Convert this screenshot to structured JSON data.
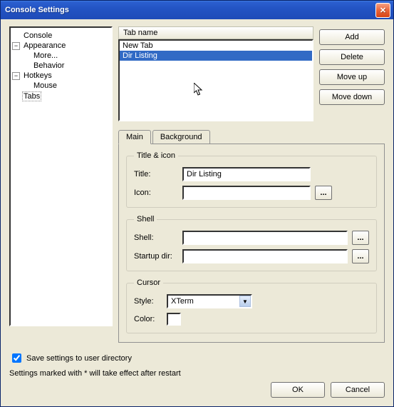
{
  "window": {
    "title": "Console Settings"
  },
  "tree": {
    "items": [
      {
        "label": "Console",
        "level": 0,
        "expand": "leaf"
      },
      {
        "label": "Appearance",
        "level": 0,
        "expand": "minus"
      },
      {
        "label": "More...",
        "level": 1,
        "expand": "leaf"
      },
      {
        "label": "Behavior",
        "level": 1,
        "expand": "leaf"
      },
      {
        "label": "Hotkeys",
        "level": 0,
        "expand": "minus"
      },
      {
        "label": "Mouse",
        "level": 1,
        "expand": "leaf"
      },
      {
        "label": "Tabs",
        "level": 0,
        "expand": "leaf",
        "selected": true
      }
    ]
  },
  "tabs_panel": {
    "header": "Tab name",
    "items": [
      "New Tab",
      "Dir Listing"
    ],
    "selected_index": 1,
    "buttons": {
      "add": "Add",
      "delete": "Delete",
      "move_up": "Move up",
      "move_down": "Move down"
    }
  },
  "detail_tabs": {
    "main": "Main",
    "background": "Background",
    "active": "main"
  },
  "title_icon": {
    "legend": "Title & icon",
    "title_label": "Title:",
    "title_value": "Dir Listing",
    "icon_label": "Icon:",
    "icon_value": ""
  },
  "shell": {
    "legend": "Shell",
    "shell_label": "Shell:",
    "shell_value": "",
    "startup_label": "Startup dir:",
    "startup_value": ""
  },
  "cursor": {
    "legend": "Cursor",
    "style_label": "Style:",
    "style_value": "XTerm",
    "color_label": "Color:"
  },
  "footer": {
    "checkbox_label": "Save settings to user directory",
    "checkbox_checked": true,
    "note": "Settings marked with * will take effect after restart",
    "ok": "OK",
    "cancel": "Cancel"
  }
}
